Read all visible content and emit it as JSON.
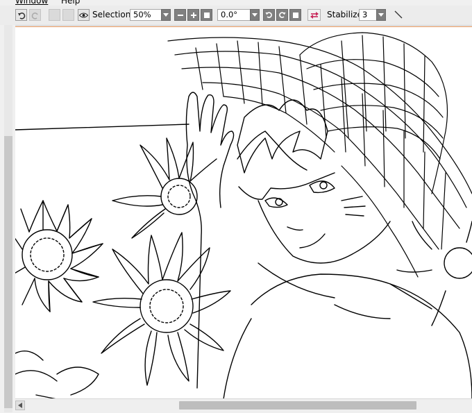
{
  "menu": {
    "items": [
      "Window",
      "Help"
    ]
  },
  "toolbar": {
    "selection_label": "Selection",
    "zoom_value": "50%",
    "rotation_value": "0.0°",
    "stabilizer_label": "Stabilizer",
    "stabilizer_value": "3"
  },
  "icons": {
    "undo": "undo-icon",
    "redo": "redo-icon",
    "eye": "eye-icon",
    "zoom_out": "minus-icon",
    "zoom_in": "plus-icon",
    "zoom_reset": "square-icon",
    "rotate_left": "rotate-left-icon",
    "rotate_right": "rotate-right-icon",
    "rotate_reset": "square-icon",
    "flip": "flip-horizontal-icon",
    "pen": "pen-line-icon"
  },
  "colors": {
    "canvas_border": "#e2945a",
    "flip_accent": "#c8285a"
  },
  "canvas": {
    "artwork": "line-art-boy-straw-hat-sunflowers"
  }
}
